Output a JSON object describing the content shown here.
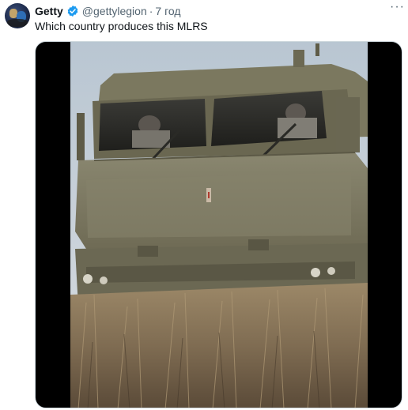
{
  "tweet": {
    "display_name": "Getty",
    "handle": "@gettylegion",
    "separator": "·",
    "time": "7 год",
    "text": "Which country produces this MLRS",
    "more_icon": "more-horizontal-icon",
    "verified_icon": "verified-badge-icon",
    "media_kind": "video-frame"
  },
  "colors": {
    "primary_text": "#0f1419",
    "secondary_text": "#536471",
    "verified_blue": "#1d9bf0",
    "vehicle_olive": "#7a7860",
    "grass": "#8c7a5e",
    "sky": "#c8d1da"
  }
}
